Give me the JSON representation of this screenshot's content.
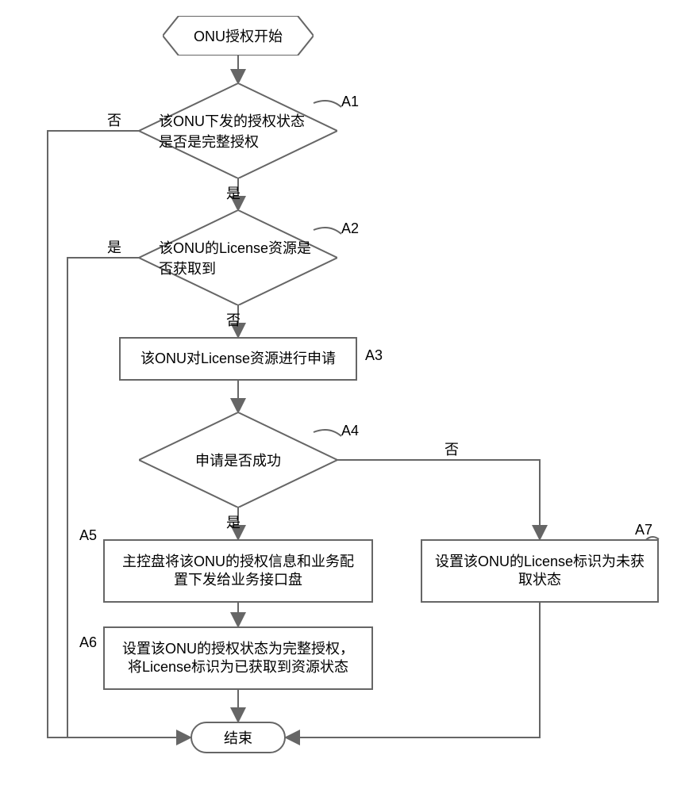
{
  "chart_data": {
    "type": "flowchart",
    "title": "",
    "nodes": [
      {
        "id": "start",
        "shape": "terminator",
        "label": "ONU授权开始"
      },
      {
        "id": "A1",
        "shape": "decision",
        "label": "该ONU下发的授权状态是否是完整授权",
        "tag": "A1"
      },
      {
        "id": "A2",
        "shape": "decision",
        "label": "该ONU的License资源是否获取到",
        "tag": "A2"
      },
      {
        "id": "A3",
        "shape": "process",
        "label": "该ONU对License资源进行申请",
        "tag": "A3"
      },
      {
        "id": "A4",
        "shape": "decision",
        "label": "申请是否成功",
        "tag": "A4"
      },
      {
        "id": "A5",
        "shape": "process",
        "label": "主控盘将该ONU的授权信息和业务配置下发给业务接口盘",
        "tag": "A5"
      },
      {
        "id": "A6",
        "shape": "process",
        "label": "设置该ONU的授权状态为完整授权，将License标识为已获取到资源状态",
        "tag": "A6"
      },
      {
        "id": "A7",
        "shape": "process",
        "label": "设置该ONU的License标识为未获取状态",
        "tag": "A7"
      },
      {
        "id": "end",
        "shape": "terminator",
        "label": "结束"
      }
    ],
    "edges": [
      {
        "from": "start",
        "to": "A1",
        "label": ""
      },
      {
        "from": "A1",
        "to": "A2",
        "label": "是"
      },
      {
        "from": "A1",
        "to": "end",
        "label": "否"
      },
      {
        "from": "A2",
        "to": "A3",
        "label": "否"
      },
      {
        "from": "A2",
        "to": "end",
        "label": "是"
      },
      {
        "from": "A3",
        "to": "A4",
        "label": ""
      },
      {
        "from": "A4",
        "to": "A5",
        "label": "是"
      },
      {
        "from": "A4",
        "to": "A7",
        "label": "否"
      },
      {
        "from": "A5",
        "to": "A6",
        "label": ""
      },
      {
        "from": "A6",
        "to": "end",
        "label": ""
      },
      {
        "from": "A7",
        "to": "end",
        "label": ""
      }
    ]
  },
  "labels": {
    "start": "ONU授权开始",
    "a1": "该ONU下发的授权状态是否是完整授权",
    "a2": "该ONU的License资源是否获取到",
    "a3": "该ONU对License资源进行申请",
    "a4": "申请是否成功",
    "a5": "主控盘将该ONU的授权信息和业务配置下发给业务接口盘",
    "a6": "设置该ONU的授权状态为完整授权，将License标识为已获取到资源状态",
    "a7": "设置该ONU的License标识为未获取状态",
    "end": "结束",
    "yes": "是",
    "no": "否",
    "tag_a1": "A1",
    "tag_a2": "A2",
    "tag_a3": "A3",
    "tag_a4": "A4",
    "tag_a5": "A5",
    "tag_a6": "A6",
    "tag_a7": "A7"
  }
}
